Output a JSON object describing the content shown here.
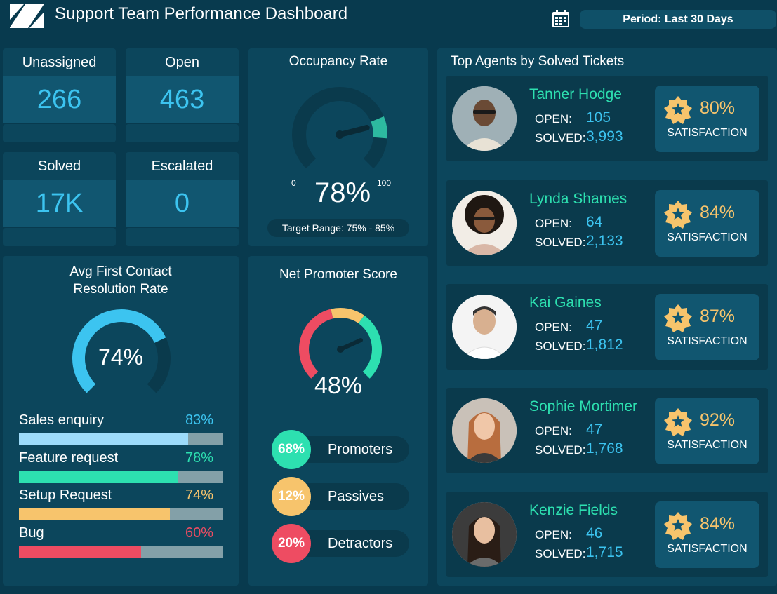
{
  "header": {
    "title": "Support Team Performance Dashboard",
    "period": "Period: Last 30 Days"
  },
  "kpis": [
    {
      "label": "Unassigned",
      "value": "266"
    },
    {
      "label": "Open",
      "value": "463"
    },
    {
      "label": "Solved",
      "value": "17K"
    },
    {
      "label": "Escalated",
      "value": "0"
    }
  ],
  "occupancy": {
    "title": "Occupancy Rate",
    "value": "78%",
    "min": "0",
    "max": "100",
    "level": 0.78,
    "target": "Target Range: 75% - 85%"
  },
  "fcr": {
    "title_line1": "Avg First Contact",
    "title_line2": "Resolution Rate",
    "value": "74%",
    "level": 0.74,
    "categories": [
      {
        "label": "Sales enquiry",
        "pct": "83%",
        "level": 0.83,
        "color": "#9ddbfa"
      },
      {
        "label": "Feature request",
        "pct": "78%",
        "level": 0.78,
        "color": "#2de0b0"
      },
      {
        "label": "Setup Request",
        "pct": "74%",
        "level": 0.74,
        "color": "#f7c46c"
      },
      {
        "label": "Bug",
        "pct": "60%",
        "level": 0.6,
        "color": "#ee4c62"
      }
    ]
  },
  "nps": {
    "title": "Net Promoter Score",
    "value": "48%",
    "segments": [
      {
        "pct": "68%",
        "label": "Promoters",
        "color": "#2de0b0"
      },
      {
        "pct": "12%",
        "label": "Passives",
        "color": "#f7c46c"
      },
      {
        "pct": "20%",
        "label": "Detractors",
        "color": "#ee4c62"
      }
    ]
  },
  "agents": {
    "title": "Top Agents by Solved Tickets",
    "open_label": "OPEN:",
    "solved_label": "SOLVED:",
    "satisfaction_label": "SATISFACTION",
    "items": [
      {
        "name": "Tanner Hodge",
        "open": "105",
        "solved": "3,993",
        "satisfaction": "80%"
      },
      {
        "name": "Lynda Shames",
        "open": "64",
        "solved": "2,133",
        "satisfaction": "84%"
      },
      {
        "name": "Kai Gaines",
        "open": "47",
        "solved": "1,812",
        "satisfaction": "87%"
      },
      {
        "name": "Sophie Mortimer",
        "open": "47",
        "solved": "1,768",
        "satisfaction": "92%"
      },
      {
        "name": "Kenzie Fields",
        "open": "46",
        "solved": "1,715",
        "satisfaction": "84%"
      }
    ]
  },
  "colors": {
    "background": "#083a4e",
    "panel": "#0c465c",
    "accent_blue": "#3cc4f0",
    "accent_green": "#2de0b0",
    "accent_yellow": "#f7c46c",
    "accent_red": "#ee4c62"
  }
}
